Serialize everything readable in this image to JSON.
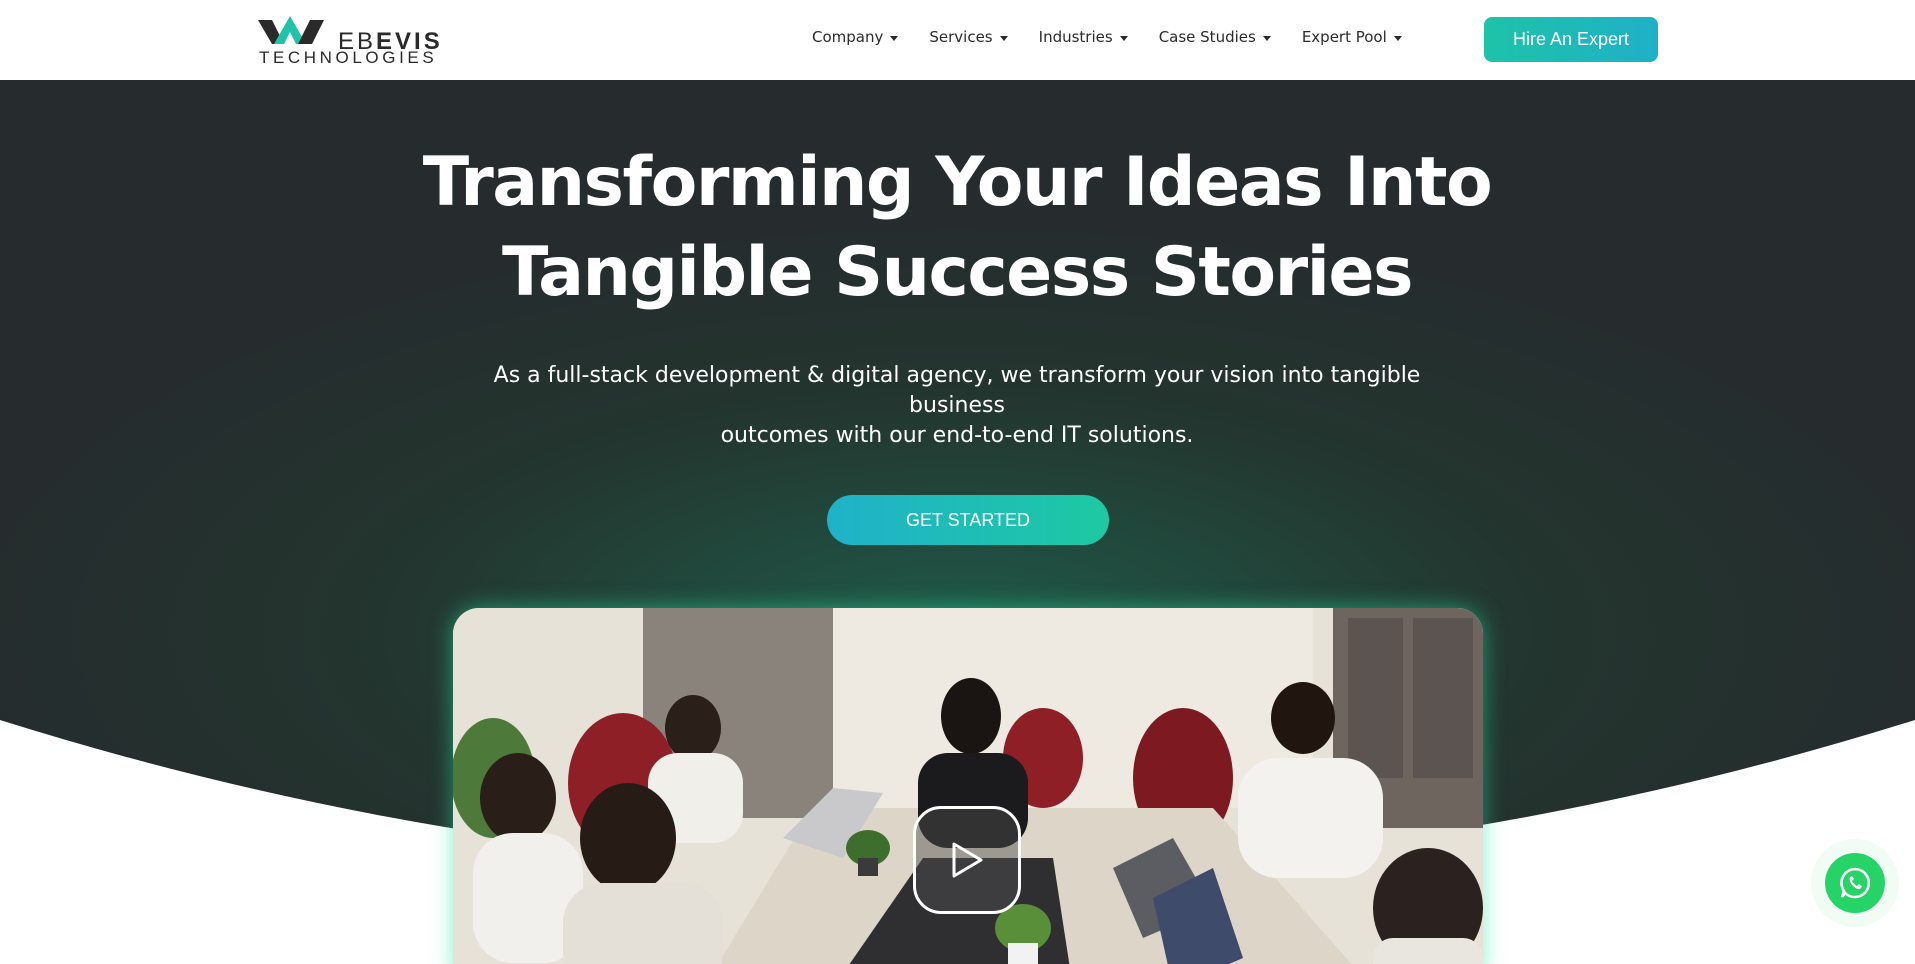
{
  "brand": {
    "word_thin": "EB",
    "word_bold": "EVIS",
    "sub": "TECHNOLOGIES",
    "accent": "#1ec3a8",
    "dark": "#2a2a2a"
  },
  "nav": {
    "items": [
      {
        "label": "Company"
      },
      {
        "label": "Services"
      },
      {
        "label": "Industries"
      },
      {
        "label": "Case Studies"
      },
      {
        "label": "Expert Pool"
      }
    ],
    "cta_label": "Hire An Expert"
  },
  "hero": {
    "title_line1": "Transforming Your Ideas Into",
    "title_line2": "Tangible Success Stories",
    "subtitle_line1": "As a full-stack development & digital agency, we transform your vision into tangible business",
    "subtitle_line2": "outcomes with our end-to-end IT solutions.",
    "cta_label": "GET STARTED",
    "background_color": "#262b2d",
    "glow_color": "#1f4a3e"
  },
  "video": {
    "play_icon": "play-icon"
  },
  "floating": {
    "icon": "whatsapp-icon",
    "color": "#25d366"
  }
}
